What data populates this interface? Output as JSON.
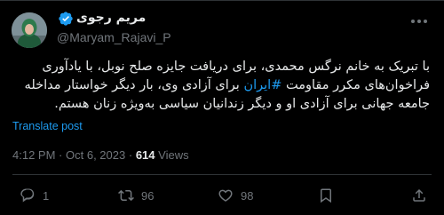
{
  "user": {
    "display_name": "مریم رجوی",
    "handle": "@Maryam_Rajavi_P"
  },
  "tweet": {
    "lines": [
      "با تبریک به خانم نرگس محمدی، برای دریافت جایزه صلح نوبل، با یادآوری",
      "فراخوان‌های مکرر مقاومت ",
      " برای آزادی وی، بار دیگر خواستار مداخله",
      "جامعه جهانی برای آزادی او و دیگر زندانیان سیاسی به‌ویژه زنان هستم."
    ],
    "hashtag": "#ایران"
  },
  "translate_label": "Translate post",
  "meta": {
    "time": "4:12 PM",
    "separator": "·",
    "date": "Oct 6, 2023",
    "views_count": "614",
    "views_label": "Views"
  },
  "actions": {
    "reply_count": "1",
    "repost_count": "96",
    "like_count": "98"
  },
  "colors": {
    "background": "#000000",
    "text": "#e7e9ea",
    "muted": "#71767b",
    "link": "#1d9bf0",
    "verified": "#1d9bf0",
    "divider": "#2f3336"
  },
  "icons": [
    "avatar",
    "verified-badge-icon",
    "more-options-icon",
    "reply-icon",
    "repost-icon",
    "like-icon",
    "bookmark-icon",
    "share-icon"
  ]
}
